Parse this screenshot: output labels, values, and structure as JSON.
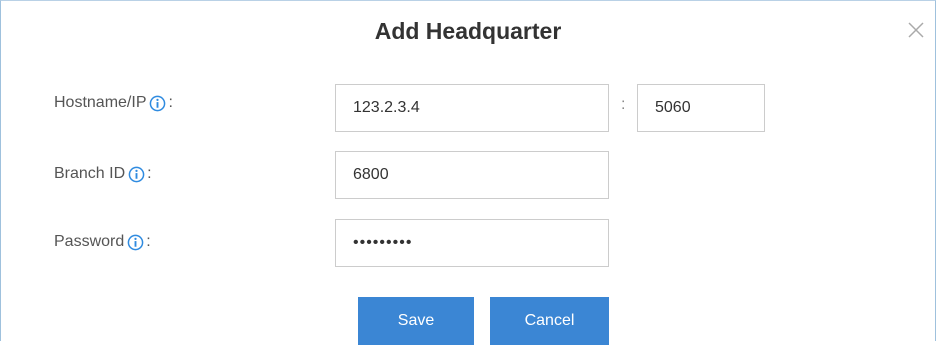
{
  "dialog": {
    "title": "Add Headquarter",
    "close_icon": "close-icon"
  },
  "fields": {
    "hostname": {
      "label": "Hostname/IP",
      "value": "123.2.3.4",
      "port": "5060",
      "separator": ":"
    },
    "branch_id": {
      "label": "Branch ID",
      "value": "6800"
    },
    "password": {
      "label": "Password",
      "value": "•••••••••"
    }
  },
  "label_suffix": ":",
  "info_icon": "info-icon",
  "buttons": {
    "save": "Save",
    "cancel": "Cancel"
  },
  "colors": {
    "primary": "#3b86d4",
    "info": "#2f8be0",
    "border": "#cccccc"
  }
}
